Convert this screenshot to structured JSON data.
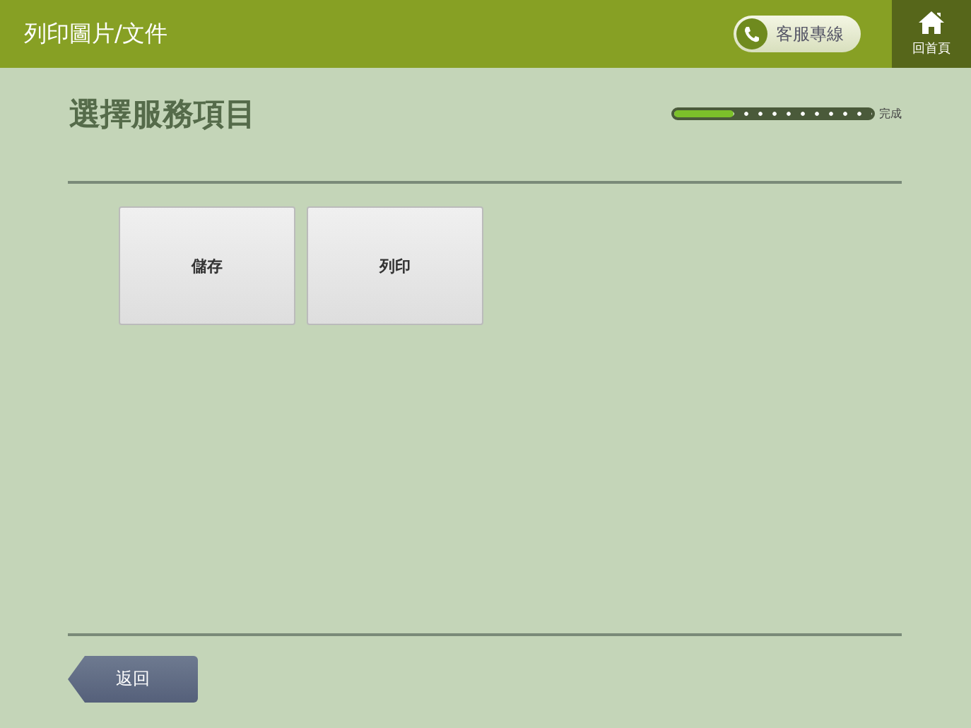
{
  "header": {
    "title": "列印圖片/文件",
    "hotline": "客服專線",
    "home": "回首頁"
  },
  "page": {
    "title": "選擇服務項目",
    "progress": {
      "level": 0.3,
      "label": "完成"
    }
  },
  "options": [
    {
      "label": "儲存"
    },
    {
      "label": "列印"
    }
  ],
  "back": "返回"
}
